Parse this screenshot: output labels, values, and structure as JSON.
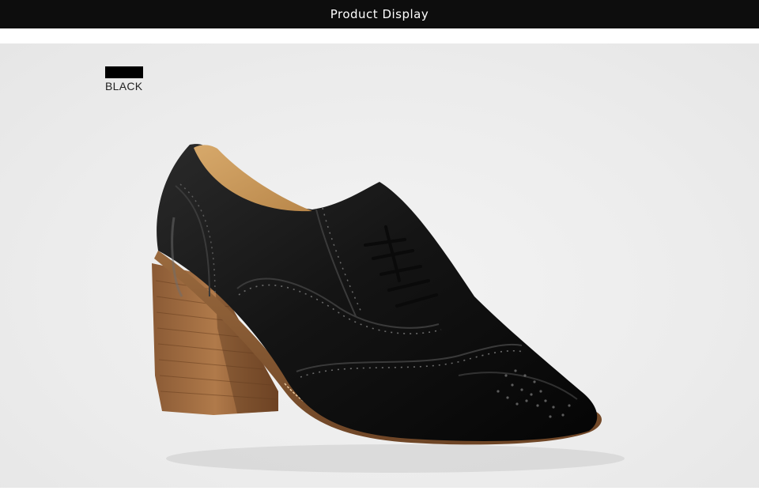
{
  "header": {
    "title": "Product Display"
  },
  "product": {
    "color_label": "BLACK",
    "swatch_color": "#000000"
  }
}
